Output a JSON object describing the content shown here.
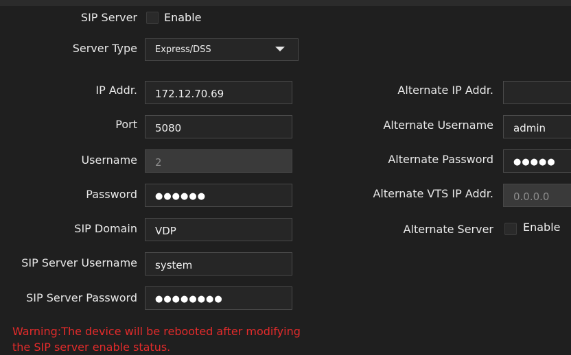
{
  "sip_server": {
    "label": "SIP Server",
    "checkbox_label": "Enable",
    "checked": false
  },
  "server_type": {
    "label": "Server Type",
    "selected": "Express/DSS"
  },
  "left_fields": [
    {
      "label": "IP Addr.",
      "value": "172.12.70.69",
      "disabled": false
    },
    {
      "label": "Port",
      "value": "5080",
      "disabled": false
    },
    {
      "label": "Username",
      "value": "2",
      "disabled": true
    },
    {
      "label": "Password",
      "value": "●●●●●●",
      "disabled": false
    },
    {
      "label": "SIP Domain",
      "value": "VDP",
      "disabled": false
    },
    {
      "label": "SIP Server Username",
      "value": "system",
      "disabled": false
    },
    {
      "label": "SIP Server Password",
      "value": "●●●●●●●●",
      "disabled": false
    }
  ],
  "right_fields": [
    {
      "label": "Alternate IP Addr.",
      "value": "",
      "disabled": false
    },
    {
      "label": "Alternate Username",
      "value": "admin",
      "disabled": false
    },
    {
      "label": "Alternate Password",
      "value": "●●●●●",
      "disabled": false
    },
    {
      "label": "Alternate VTS IP Addr.",
      "value": "0.0.0.0",
      "disabled": true
    }
  ],
  "alternate_server": {
    "label": "Alternate Server",
    "checkbox_label": "Enable",
    "checked": false
  },
  "warning": {
    "line1": "Warning:The device will be rebooted after modifying",
    "line2": "the SIP server enable status."
  },
  "colors": {
    "background": "#1f1f1f",
    "warning": "#e52b2b",
    "input_border": "#4a4a4a",
    "disabled_bg": "#3a3a3a"
  }
}
